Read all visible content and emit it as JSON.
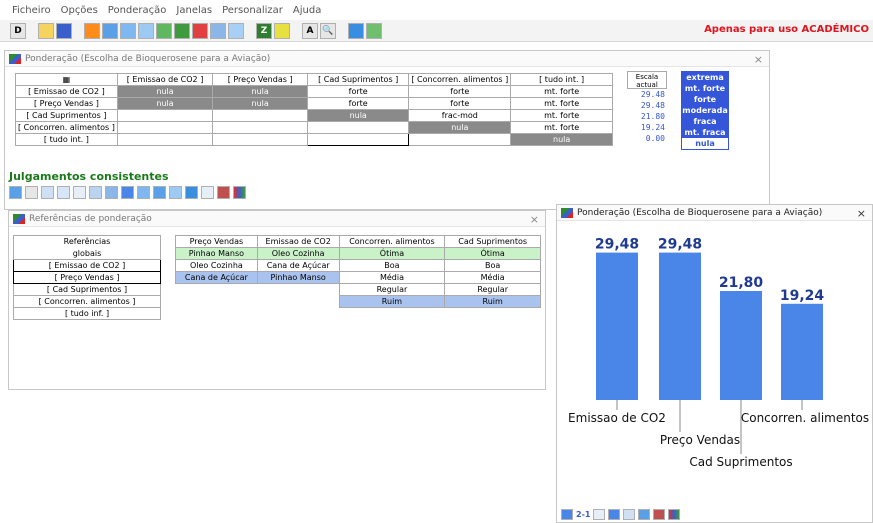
{
  "menu": [
    "Ficheiro",
    "Opções",
    "Ponderação",
    "Janelas",
    "Personalizar",
    "Ajuda"
  ],
  "academic_notice": "Apenas para uso ACADÉMICO",
  "main_window": {
    "title": "Ponderação (Escolha de Bioquerosene para a Aviação)",
    "columns": [
      "[ Emissao de CO2 ]",
      "[ Preço Vendas ]",
      "[ Cad Suprimentos ]",
      "[ Concorren. alimentos ]",
      "[ tudo int. ]"
    ],
    "rows": [
      {
        "label": "[ Emissao de CO2 ]",
        "cells": [
          "nula",
          "nula",
          "forte",
          "forte",
          "mt. forte"
        ]
      },
      {
        "label": "[ Preço Vendas ]",
        "cells": [
          "nula",
          "nula",
          "forte",
          "forte",
          "mt. forte"
        ]
      },
      {
        "label": "[ Cad Suprimentos ]",
        "cells": [
          "",
          "",
          "nula",
          "frac-mod",
          "mt. forte"
        ]
      },
      {
        "label": "[ Concorren. alimentos ]",
        "cells": [
          "",
          "",
          "",
          "nula",
          "mt. forte"
        ]
      },
      {
        "label": "[ tudo int. ]",
        "cells": [
          "",
          "",
          "",
          "",
          "nula"
        ]
      }
    ],
    "scale_header": "Escala actual",
    "scale_values": [
      "29.48",
      "29.48",
      "21.80",
      "19.24",
      "0.00"
    ],
    "scale_labels": [
      "extrema",
      "mt. forte",
      "forte",
      "moderada",
      "fraca",
      "mt. fraca",
      "nula"
    ],
    "consistency": "Julgamentos consistentes"
  },
  "ref_window": {
    "title": "Referências de ponderação",
    "left_header": [
      "Referências",
      "globais"
    ],
    "left_items": [
      "[ Emissao de CO2 ]",
      "[ Preço Vendas ]",
      "[ Cad Suprimentos ]",
      "[ Concorren. alimentos ]",
      "[ tudo inf. ]"
    ],
    "columns": [
      "Preço Vendas",
      "Emissao de CO2",
      "Concorren. alimentos",
      "Cad Suprimentos"
    ],
    "rows": [
      [
        "Pinhao Manso",
        "Oleo Cozinha",
        "Ótima",
        "Ótima"
      ],
      [
        "Oleo Cozinha",
        "Cana de Açúcar",
        "Boa",
        "Boa"
      ],
      [
        "Cana de Açúcar",
        "Pinhao Manso",
        "Média",
        "Média"
      ],
      [
        "",
        "",
        "Regular",
        "Regular"
      ],
      [
        "",
        "",
        "Ruim",
        "Ruim"
      ]
    ]
  },
  "chart_window": {
    "title": "Ponderação (Escolha de Bioquerosene para a Aviação)",
    "footer_label": "2-1"
  },
  "chart_data": {
    "type": "bar",
    "categories": [
      "Emissao de CO2",
      "Preço Vendas",
      "Cad Suprimentos",
      "Concorren. alimentos"
    ],
    "values": [
      29.48,
      29.48,
      21.8,
      19.24
    ],
    "value_labels": [
      "29,48",
      "29,48",
      "21,80",
      "19,24"
    ],
    "bar_color": "#4a86e8",
    "value_color": "#1f3a93",
    "title": "",
    "ylim": [
      0,
      30
    ]
  }
}
